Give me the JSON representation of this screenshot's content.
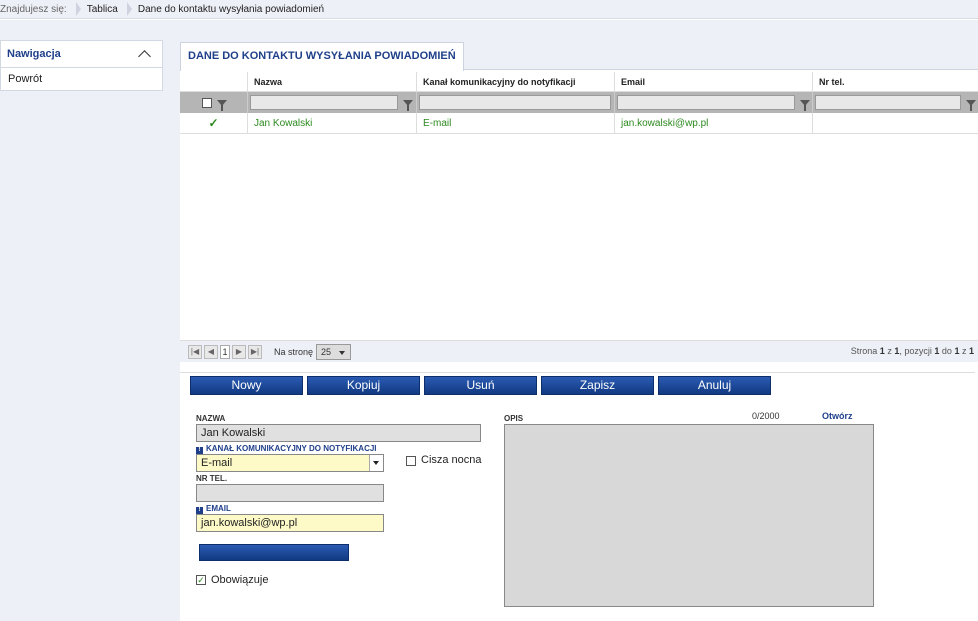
{
  "breadcrumb": {
    "lead": "Znajdujesz się:",
    "items": [
      "Tablica",
      "Dane do kontaktu wysyłania powiadomień"
    ]
  },
  "nav": {
    "title": "Nawigacja",
    "items": [
      "Powrót"
    ]
  },
  "tab": {
    "label": "DANE DO KONTAKTU WYSYŁANIA POWIADOMIEŃ"
  },
  "grid": {
    "columns": [
      "Nazwa",
      "Kanał komunikacyjny do notyfikacji",
      "Email",
      "Nr tel."
    ],
    "rows": [
      {
        "checked": "✓",
        "nazwa": "Jan Kowalski",
        "kanal": "E-mail",
        "email": "jan.kowalski@wp.pl",
        "nrtel": ""
      }
    ]
  },
  "pager": {
    "page": "1",
    "per_page_label": "Na stronę",
    "per_page": "25",
    "info_prefix": "Strona",
    "info_page": "1",
    "info_of": "z",
    "info_pages": "1",
    "info_pos": ", pozycji",
    "info_from": "1",
    "info_do": "do",
    "info_to": "1",
    "info_z": "z",
    "info_total": "1"
  },
  "toolbar": {
    "new": "Nowy",
    "copy": "Kopiuj",
    "delete": "Usuń",
    "save": "Zapisz",
    "cancel": "Anuluj"
  },
  "form": {
    "nazwa_label": "NAZWA",
    "nazwa_value": "Jan Kowalski",
    "kanal_label": "KANAŁ KOMUNIKACYJNY DO NOTYFIKACJI",
    "kanal_value": "E-mail",
    "cisza_label": "Cisza nocna",
    "nrtel_label": "NR TEL.",
    "nrtel_value": "",
    "email_label": "EMAIL",
    "email_value": "jan.kowalski@wp.pl",
    "obowiazuje_label": "Obowiązuje",
    "opis_label": "OPIS",
    "opis_counter": "0/2000",
    "opis_link": "Otwórz"
  },
  "colors": {
    "accent": "#1f3f8a",
    "button": "#1d4a9e",
    "success": "#2b8a1e",
    "required_bg": "#fdfac8"
  }
}
